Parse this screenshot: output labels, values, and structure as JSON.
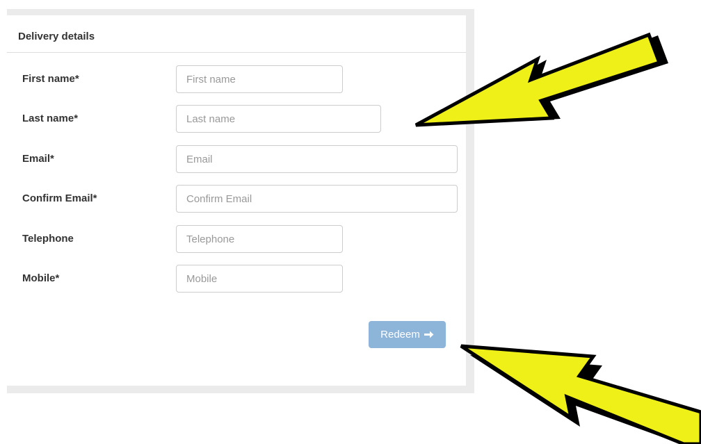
{
  "form": {
    "heading": "Delivery details",
    "fields": [
      {
        "label": "First name*",
        "placeholder": "First name",
        "value": ""
      },
      {
        "label": "Last name*",
        "placeholder": "Last name",
        "value": ""
      },
      {
        "label": "Email*",
        "placeholder": "Email",
        "value": ""
      },
      {
        "label": "Confirm Email*",
        "placeholder": "Confirm Email",
        "value": ""
      },
      {
        "label": "Telephone",
        "placeholder": "Telephone",
        "value": ""
      },
      {
        "label": "Mobile*",
        "placeholder": "Mobile",
        "value": ""
      }
    ],
    "submit_label": "Redeem",
    "submit_icon": "arrow-right-icon"
  },
  "annotations": {
    "arrow_color": "#eef018",
    "arrow_outline": "#000000"
  },
  "colors": {
    "button_bg": "#8db4d9",
    "panel_border": "#ebebeb"
  }
}
